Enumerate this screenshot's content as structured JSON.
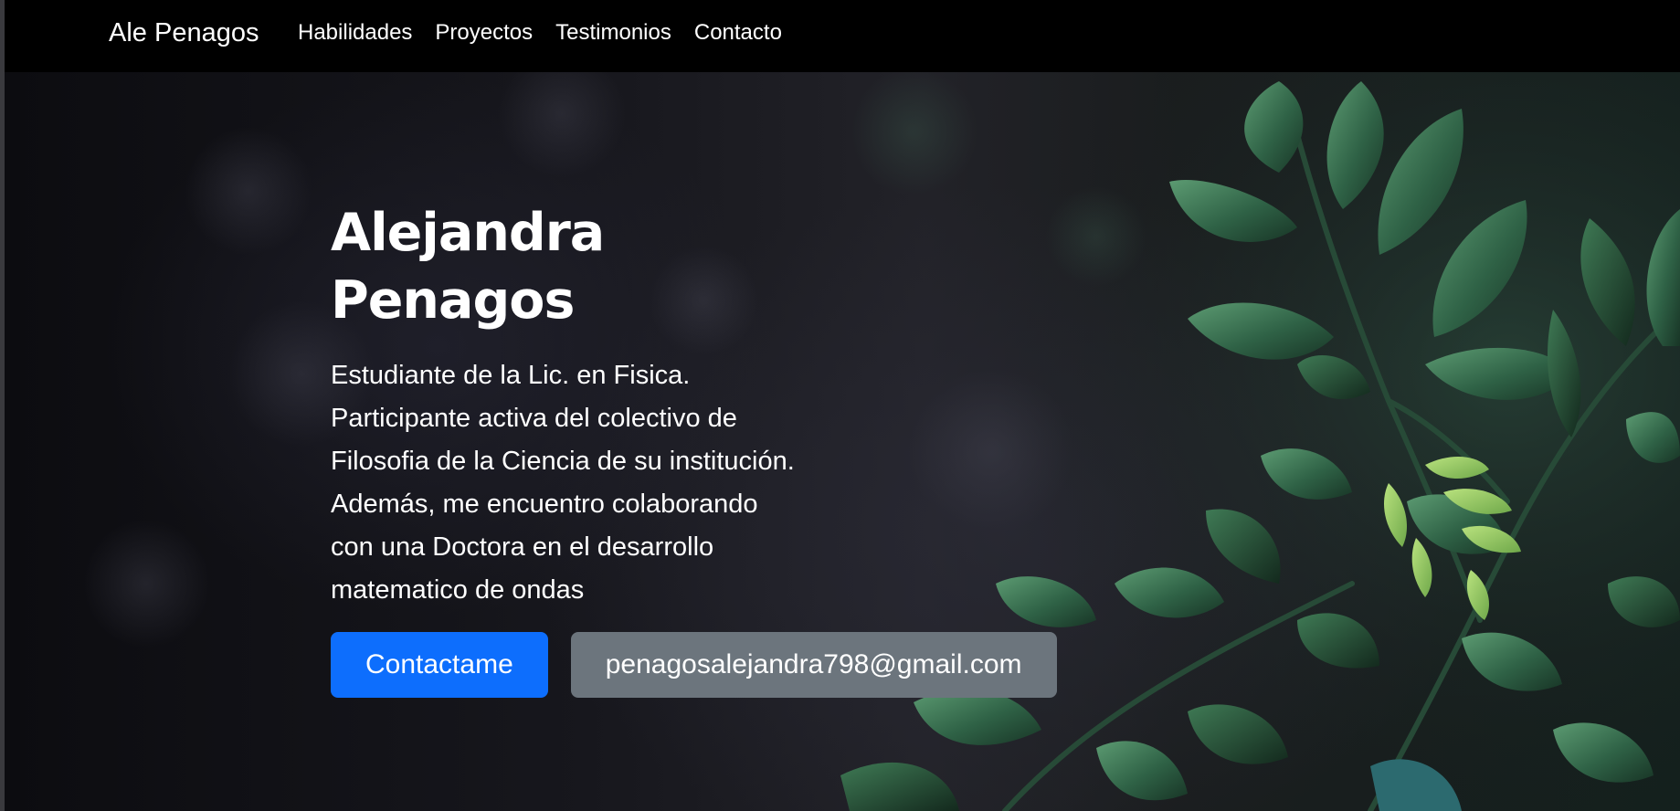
{
  "navbar": {
    "brand": "Ale Penagos",
    "links": [
      {
        "label": "Habilidades"
      },
      {
        "label": "Proyectos"
      },
      {
        "label": "Testimonios"
      },
      {
        "label": "Contacto"
      }
    ]
  },
  "hero": {
    "title": "Alejandra Penagos",
    "description": "Estudiante de la Lic. en Fisica. Participante activa del colectivo de Filosofia de la Ciencia de su institución. Además, me encuentro colaborando con una Doctora en el desarrollo matematico de ondas",
    "primary_button": "Contactame",
    "secondary_button": "penagosalejandra798@gmail.com",
    "background_image": "dark-green-leaves-bokeh"
  },
  "colors": {
    "navbar_bg": "#000000",
    "primary": "#0d6efd",
    "secondary": "#6c757d",
    "leaf_green": "#3f7a55",
    "text": "#ffffff"
  }
}
